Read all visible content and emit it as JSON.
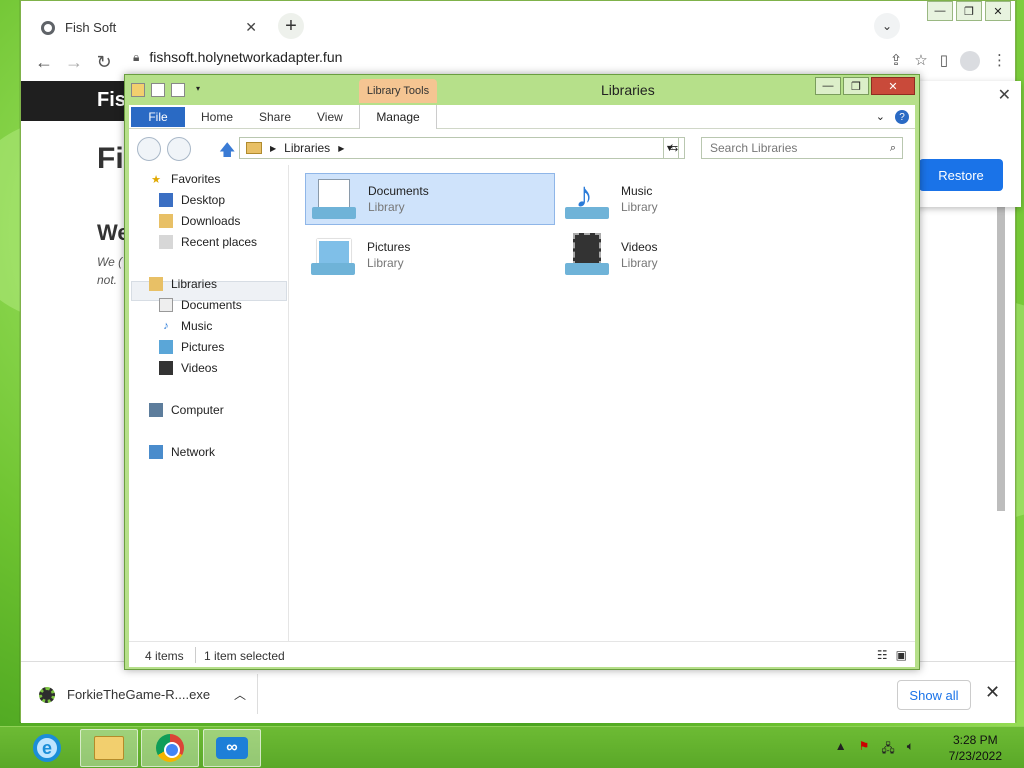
{
  "browser": {
    "tab_title": "Fish Soft",
    "tab_close": "✕",
    "new_tab": "+",
    "url": "fishsoft.holynetworkadapter.fun",
    "window_controls": [
      "—",
      "❐",
      "✕"
    ],
    "page": {
      "nav_text": "Fis",
      "heading_1": "Fi",
      "heading_2": "We",
      "paragraph_line_1": "We (",
      "paragraph_line_2": "not."
    },
    "popup": {
      "close": "✕",
      "restore_button": "Restore"
    },
    "download_bar": {
      "file_name": "ForkieTheGame-R....exe",
      "show_all": "Show all",
      "close": "✕"
    }
  },
  "explorer": {
    "title": "Libraries",
    "contextual_tab_group": "Library Tools",
    "ribbon_tabs": {
      "file": "File",
      "home": "Home",
      "share": "Share",
      "view": "View",
      "manage": "Manage"
    },
    "address": {
      "path": "Libraries"
    },
    "search_placeholder": "Search Libraries",
    "nav_pane": {
      "favorites": "Favorites",
      "desktop": "Desktop",
      "downloads": "Downloads",
      "recent_places": "Recent places",
      "libraries": "Libraries",
      "documents": "Documents",
      "music": "Music",
      "pictures": "Pictures",
      "videos": "Videos",
      "computer": "Computer",
      "network": "Network"
    },
    "items": [
      {
        "name": "Documents",
        "type": "Library"
      },
      {
        "name": "Music",
        "type": "Library"
      },
      {
        "name": "Pictures",
        "type": "Library"
      },
      {
        "name": "Videos",
        "type": "Library"
      }
    ],
    "status": {
      "count": "4 items",
      "selection": "1 item selected"
    }
  },
  "taskbar": {
    "time": "3:28 PM",
    "date": "7/23/2022"
  }
}
